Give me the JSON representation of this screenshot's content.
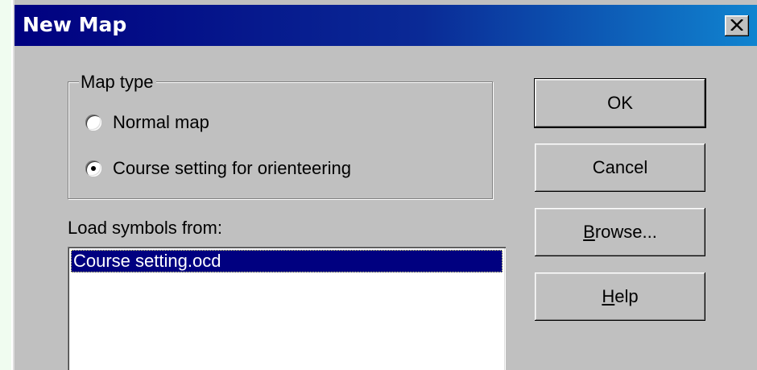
{
  "window": {
    "title": "New Map",
    "close_icon": "close-icon"
  },
  "map_type": {
    "legend": "Map type",
    "options": [
      {
        "label": "Normal map",
        "selected": false
      },
      {
        "label": "Course setting for orienteering",
        "selected": true
      }
    ]
  },
  "symbols": {
    "label": "Load symbols from:",
    "items": [
      {
        "label": "Course setting.ocd",
        "selected": true
      }
    ]
  },
  "buttons": {
    "ok": "OK",
    "cancel": "Cancel",
    "browse_mnemonic": "B",
    "browse_rest": "rowse...",
    "help_mnemonic": "H",
    "help_rest": "elp"
  },
  "colors": {
    "title_gradient_start": "#000080",
    "title_gradient_end": "#1084d0",
    "face": "#c0c0c0",
    "selection": "#000080"
  }
}
